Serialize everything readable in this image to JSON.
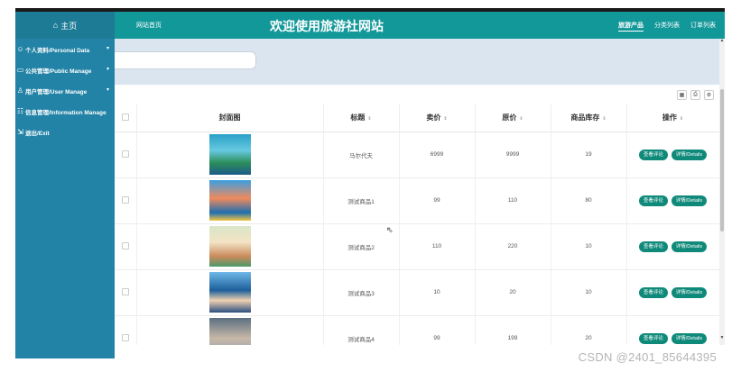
{
  "sidebar": {
    "home_label": "主页",
    "items": [
      {
        "label": "个人资料/Personal Data",
        "icon": "user-icon",
        "has_chevron": true
      },
      {
        "label": "公共管理/Public Manage",
        "icon": "monitor-icon",
        "has_chevron": true
      },
      {
        "label": "用户管理/User Manage",
        "icon": "user-outline-icon",
        "has_chevron": true
      },
      {
        "label": "信息管理/Information Manage",
        "icon": "info-icon",
        "has_chevron": false
      },
      {
        "label": "退出/Exit",
        "icon": "exit-icon",
        "has_chevron": false
      }
    ]
  },
  "header": {
    "brand": "网站首页",
    "title": "欢迎使用旅游社网站",
    "nav": [
      "旅游产品",
      "分类列表",
      "订单列表"
    ]
  },
  "table": {
    "columns": [
      "封面图",
      "标题",
      "卖价",
      "原价",
      "商品库存",
      "操作"
    ],
    "rows": [
      {
        "title": "马尔代夫",
        "price": "6999",
        "orig": "9999",
        "stock": "19"
      },
      {
        "title": "测试商品1",
        "price": "99",
        "orig": "110",
        "stock": "80"
      },
      {
        "title": "测试商品2",
        "price": "110",
        "orig": "220",
        "stock": "10"
      },
      {
        "title": "测试商品3",
        "price": "10",
        "orig": "20",
        "stock": "10"
      },
      {
        "title": "测试商品4",
        "price": "99",
        "orig": "199",
        "stock": "20"
      }
    ],
    "action_review": "查看评论",
    "action_details": "详情/Details"
  },
  "watermark": "CSDN @2401_85644395",
  "colors": {
    "header": "#13989a",
    "sidebar": "#2283a6",
    "button": "#0f8a7a"
  }
}
